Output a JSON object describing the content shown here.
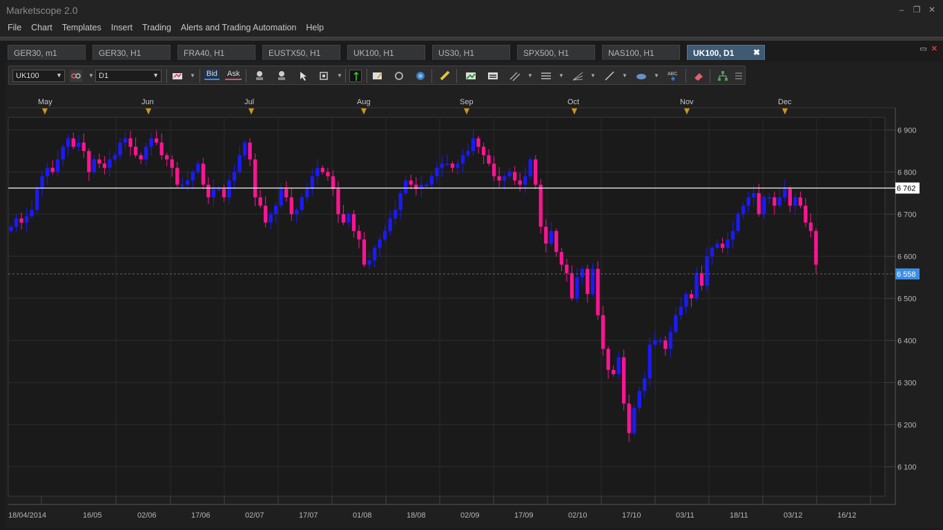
{
  "app": {
    "title": "Marketscope 2.0"
  },
  "window_controls": {
    "minimize": "–",
    "restore": "❐",
    "close": "✕"
  },
  "menu": [
    "File",
    "Chart",
    "Templates",
    "Insert",
    "Trading",
    "Alerts and Trading Automation",
    "Help"
  ],
  "tabs": [
    {
      "label": "GER30, m1",
      "active": false
    },
    {
      "label": "GER30, H1",
      "active": false
    },
    {
      "label": "FRA40, H1",
      "active": false
    },
    {
      "label": "EUSTX50, H1",
      "active": false
    },
    {
      "label": "UK100, H1",
      "active": false
    },
    {
      "label": "US30, H1",
      "active": false
    },
    {
      "label": "SPX500, H1",
      "active": false
    },
    {
      "label": "NAS100, H1",
      "active": false
    },
    {
      "label": "UK100, D1",
      "active": true
    }
  ],
  "tab_close": "✖",
  "toolbar": {
    "instrument": "UK100",
    "timeframe": "D1",
    "bid_label": "Bid",
    "ask_label": "Ask",
    "tools": [
      "candle-type-icon",
      "zoom-in-icon",
      "zoom-out-icon",
      "cursor-icon",
      "zoom-region-icon",
      "crosshair-icon",
      "chart-settings-icon",
      "refresh-icon",
      "globe-icon",
      "ruler-icon",
      "insert-indicator-icon",
      "template-icon",
      "channel-icon",
      "levels-icon",
      "fan-icon",
      "line-icon",
      "shape-icon",
      "text-icon",
      "eraser-icon",
      "hierarchy-icon",
      "more-icon"
    ]
  },
  "colors": {
    "bull": "#1a1aff",
    "bear": "#ff1493",
    "background": "#1b1b1b",
    "grid": "#333333",
    "marker": "#c8961e",
    "current_price": "#3a8ee6"
  },
  "chart_data": {
    "type": "candlestick",
    "instrument": "UK100",
    "timeframe": "D1",
    "ylim": [
      6030,
      6950
    ],
    "yticks": [
      "6 900",
      "6 800",
      "6 700",
      "6 600",
      "6 500",
      "6 400",
      "6 300",
      "6 200",
      "6 100"
    ],
    "ytick_values": [
      6900,
      6800,
      6700,
      6600,
      6500,
      6400,
      6300,
      6200,
      6100
    ],
    "month_markers": [
      "May",
      "Jun",
      "Jul",
      "Aug",
      "Sep",
      "Oct",
      "Nov",
      "Dec"
    ],
    "date_labels": [
      "18/04/2014",
      "16/05",
      "02/06",
      "17/06",
      "02/07",
      "17/07",
      "01/08",
      "18/08",
      "02/09",
      "17/09",
      "02/10",
      "17/10",
      "03/11",
      "18/11",
      "03/12",
      "16/12"
    ],
    "horizontal_line": {
      "value": 6762,
      "label": "6 762"
    },
    "current_price": {
      "value": 6558,
      "label": "6 558"
    },
    "closes": [
      6670,
      6690,
      6680,
      6695,
      6710,
      6760,
      6790,
      6810,
      6800,
      6830,
      6860,
      6880,
      6860,
      6870,
      6850,
      6800,
      6830,
      6820,
      6810,
      6830,
      6840,
      6870,
      6880,
      6860,
      6840,
      6830,
      6860,
      6880,
      6870,
      6840,
      6830,
      6810,
      6770,
      6770,
      6780,
      6800,
      6820,
      6770,
      6740,
      6760,
      6760,
      6740,
      6780,
      6800,
      6840,
      6870,
      6830,
      6740,
      6720,
      6680,
      6700,
      6720,
      6760,
      6740,
      6700,
      6710,
      6740,
      6760,
      6790,
      6810,
      6800,
      6790,
      6760,
      6700,
      6680,
      6700,
      6660,
      6640,
      6580,
      6590,
      6620,
      6640,
      6660,
      6690,
      6710,
      6750,
      6780,
      6770,
      6760,
      6770,
      6770,
      6790,
      6810,
      6820,
      6820,
      6810,
      6820,
      6840,
      6850,
      6880,
      6860,
      6840,
      6820,
      6790,
      6780,
      6790,
      6800,
      6780,
      6770,
      6790,
      6830,
      6770,
      6670,
      6630,
      6660,
      6610,
      6580,
      6560,
      6500,
      6550,
      6570,
      6510,
      6570,
      6460,
      6380,
      6330,
      6320,
      6360,
      6250,
      6180,
      6240,
      6280,
      6310,
      6390,
      6400,
      6400,
      6380,
      6420,
      6460,
      6480,
      6510,
      6500,
      6560,
      6530,
      6600,
      6620,
      6630,
      6620,
      6640,
      6660,
      6700,
      6720,
      6740,
      6750,
      6700,
      6740,
      6740,
      6720,
      6740,
      6760,
      6720,
      6740,
      6720,
      6680,
      6660,
      6580
    ]
  }
}
